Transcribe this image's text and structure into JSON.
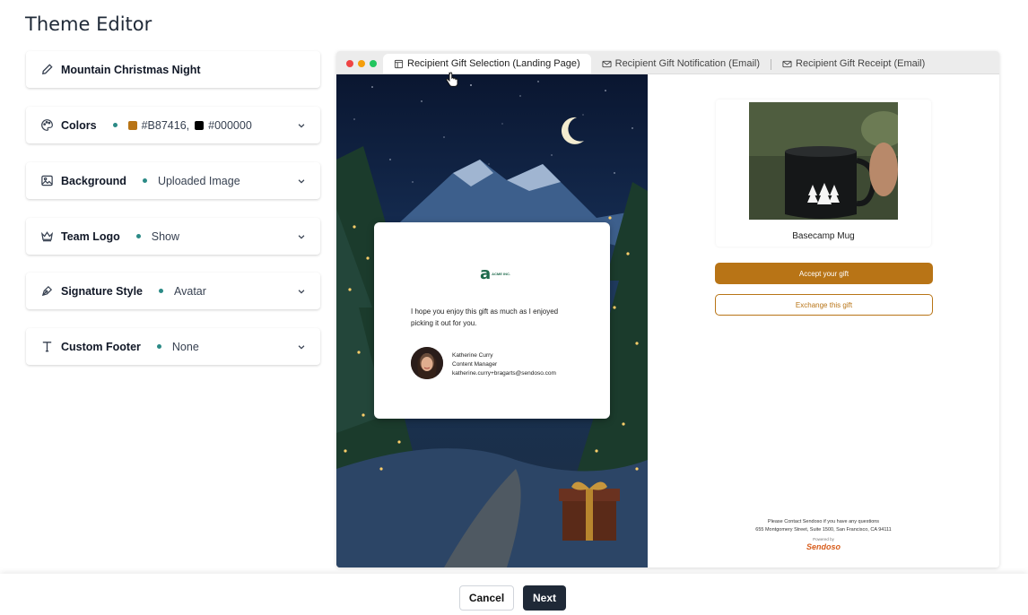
{
  "page": {
    "title": "Theme Editor"
  },
  "theme_settings": {
    "name": {
      "label": "Mountain Christmas Night",
      "icon": "pencil-icon"
    },
    "colors": {
      "label": "Colors",
      "icon": "palette-icon",
      "primary": "#B87416",
      "secondary": "#000000",
      "primary_label": "#B87416,",
      "secondary_label": "#000000"
    },
    "background": {
      "label": "Background",
      "icon": "image-icon",
      "value": "Uploaded Image"
    },
    "team_logo": {
      "label": "Team Logo",
      "icon": "crown-icon",
      "value": "Show"
    },
    "signature_style": {
      "label": "Signature Style",
      "icon": "pen-nib-icon",
      "value": "Avatar"
    },
    "custom_footer": {
      "label": "Custom Footer",
      "icon": "text-icon",
      "value": "None"
    }
  },
  "preview": {
    "tabs": [
      {
        "label": "Recipient Gift Selection (Landing Page)",
        "icon": "layout-icon",
        "active": true
      },
      {
        "label": "Recipient Gift Notification (Email)",
        "icon": "mail-icon",
        "active": false
      },
      {
        "label": "Recipient Gift Receipt (Email)",
        "icon": "mail-icon",
        "active": false
      }
    ],
    "message_card": {
      "logo_text": "ACME INC.",
      "message": "I hope you enjoy this gift as much as I enjoyed picking it out for you.",
      "sender_name": "Katherine Curry",
      "sender_title": "Content Manager",
      "sender_email": "katherine.curry+bragarts@sendoso.com"
    },
    "product": {
      "name": "Basecamp Mug"
    },
    "accept_label": "Accept your gift",
    "exchange_label": "Exchange this gift",
    "footer_line1": "Please Contact Sendoso if you have any questions",
    "footer_line2": "655 Montgomery Street, Suite 1500, San Francisco, CA 94111",
    "powered_by": "Powered by",
    "brand": "Sendoso"
  },
  "actions": {
    "cancel_label": "Cancel",
    "next_label": "Next"
  },
  "colors": {
    "accent": "#B87416",
    "dot": "#2b8a86",
    "next_bg": "#1f2937"
  }
}
